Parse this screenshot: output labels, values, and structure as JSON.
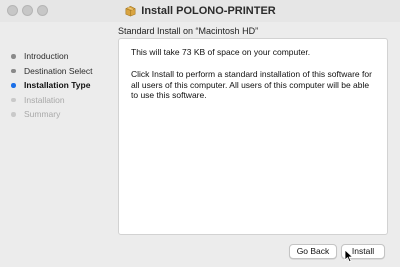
{
  "window": {
    "title": "Install POLONO-PRINTER",
    "title_icon": "package-icon"
  },
  "traffic_lights": [
    "close",
    "minimize",
    "zoom"
  ],
  "header": {
    "subtitle": "Standard Install on “Macintosh HD”"
  },
  "sidebar": {
    "steps": [
      {
        "label": "Introduction",
        "state": "done"
      },
      {
        "label": "Destination Select",
        "state": "done"
      },
      {
        "label": "Installation Type",
        "state": "active"
      },
      {
        "label": "Installation",
        "state": "future"
      },
      {
        "label": "Summary",
        "state": "future"
      }
    ]
  },
  "content": {
    "paragraph_1": "This will take 73 KB of space on your computer.",
    "paragraph_2": "Click Install to perform a standard installation of this software for all users of this computer. All users of this computer will be able to use this software."
  },
  "buttons": {
    "go_back": "Go Back",
    "install": "Install"
  },
  "colors": {
    "accent": "#1b6fe8",
    "window_bg": "#ececec",
    "panel_bg": "#ffffff"
  }
}
